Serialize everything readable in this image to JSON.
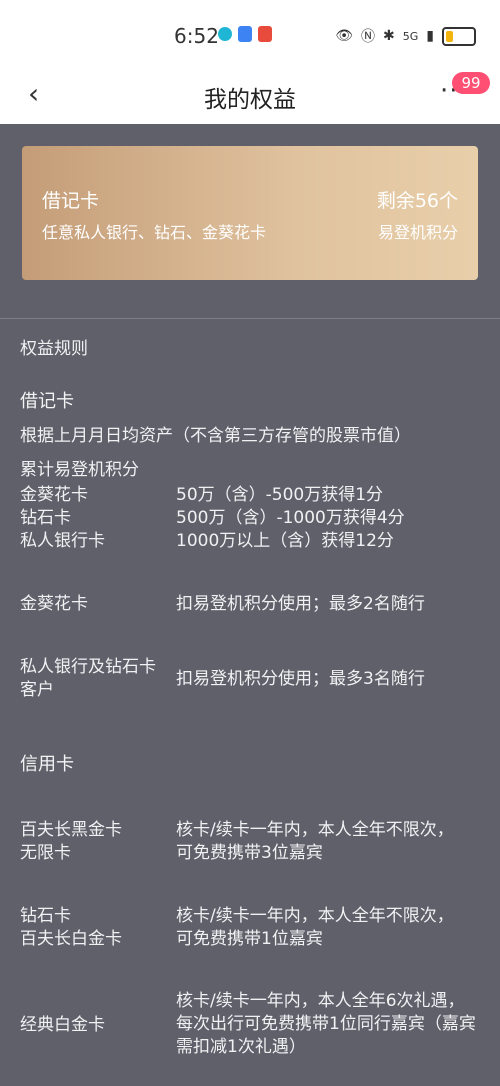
{
  "status": {
    "time": "6:52",
    "network": "5G",
    "app_colors": [
      "#1fb6d6",
      "#3d83f3",
      "#e84b3c"
    ]
  },
  "nav": {
    "title": "我的权益",
    "badge": "99",
    "more": "···"
  },
  "card": {
    "title": "借记卡",
    "desc": "任意私人银行、钻石、金葵花卡",
    "remaining": "剩余56个",
    "unit": "易登机积分"
  },
  "rules": {
    "heading": "权益规则",
    "debit": {
      "title": "借记卡",
      "basis": "根据上月月日均资产（不含第三方存管的股票市值）",
      "accum": "累计易登机积分",
      "tiers": [
        {
          "card": "金葵花卡",
          "rule": "50万（含）-500万获得1分"
        },
        {
          "card": "钻石卡",
          "rule": "500万（含）-1000万获得4分"
        },
        {
          "card": "私人银行卡",
          "rule": "1000万以上（含）获得12分"
        }
      ],
      "benefits": [
        {
          "card": "金葵花卡",
          "text": "扣易登机积分使用；最多2名随行"
        },
        {
          "card_line1": "私人银行及钻石卡",
          "card_line2": "客户",
          "text": "扣易登机积分使用；最多3名随行"
        }
      ]
    },
    "credit": {
      "title": "信用卡",
      "items": [
        {
          "card_line1": "百夫长黑金卡",
          "card_line2": "无限卡",
          "text": "核卡/续卡一年内，本人全年不限次，可免费携带3位嘉宾"
        },
        {
          "card_line1": "钻石卡",
          "card_line2": "百夫长白金卡",
          "text": "核卡/续卡一年内，本人全年不限次，可免费携带1位嘉宾"
        },
        {
          "card_line1": "经典白金卡",
          "text": "核卡/续卡一年内，本人全年6次礼遇，每次出行可免费携带1位同行嘉宾（嘉宾需扣减1次礼遇）"
        }
      ]
    }
  }
}
